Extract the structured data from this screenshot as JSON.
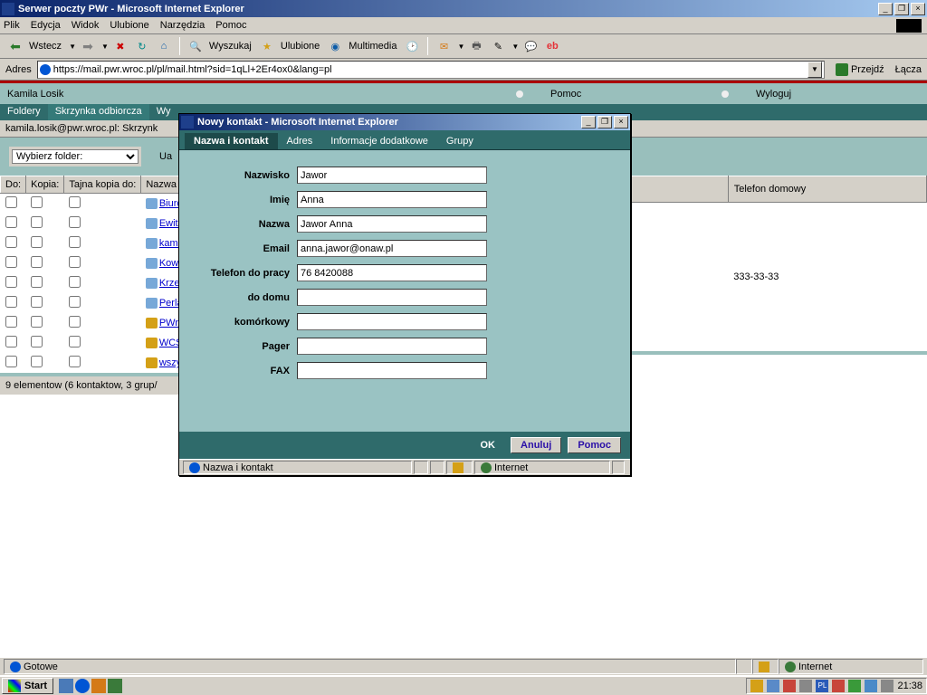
{
  "mainwin": {
    "title": "Serwer poczty PWr - Microsoft Internet Explorer",
    "menu": [
      "Plik",
      "Edycja",
      "Widok",
      "Ulubione",
      "Narzędzia",
      "Pomoc"
    ],
    "toolbar": {
      "back": "Wstecz",
      "search": "Wyszukaj",
      "fav": "Ulubione",
      "media": "Multimedia"
    },
    "addrlabel": "Adres",
    "url": "https://mail.pwr.wroc.pl/pl/mail.html?sid=1qLl+2Er4ox0&lang=pl",
    "go": "Przejdź",
    "links": "Łącza"
  },
  "web": {
    "user": "Kamila Losik",
    "nav": {
      "help": "Pomoc",
      "logout": "Wyloguj"
    },
    "tabs": [
      "Foldery",
      "Skrzynka odbiorcza",
      "Wy"
    ],
    "subhdr": "kamila.losik@pwr.wroc.pl: Skrzynk",
    "folder_select": "Wybierz folder:",
    "ua": "Ua",
    "th": {
      "to": "Do:",
      "cc": "Kopia:",
      "bcc": "Tajna kopia do:",
      "name": "Nazwa",
      "homephone": "Telefon domowy"
    },
    "contacts": [
      "Biuro Grantó",
      "Ewita Edwar",
      "kamila.losik",
      "Kowalski To",
      "Krzewa Jasi",
      "Perla Malgo",
      "PWr",
      "WCSS",
      "wszyscy"
    ],
    "phones": [
      "",
      "",
      "",
      "",
      "333-33-33",
      "",
      "",
      "",
      ""
    ],
    "elemcount": "9 elementow (6 kontaktow, 3 grup/"
  },
  "popup": {
    "title": "Nowy kontakt - Microsoft Internet Explorer",
    "tabs": [
      "Nazwa i kontakt",
      "Adres",
      "Informacje dodatkowe",
      "Grupy"
    ],
    "fields": {
      "nazwisko": {
        "label": "Nazwisko",
        "value": "Jawor"
      },
      "imie": {
        "label": "Imię",
        "value": "Anna"
      },
      "nazwa": {
        "label": "Nazwa",
        "value": "Jawor Anna"
      },
      "email": {
        "label": "Email",
        "value": "anna.jawor@onaw.pl"
      },
      "telpraca": {
        "label": "Telefon do pracy",
        "value": "76 8420088"
      },
      "teldom": {
        "label": "do domu",
        "value": ""
      },
      "komorka": {
        "label": "komórkowy",
        "value": ""
      },
      "pager": {
        "label": "Pager",
        "value": ""
      },
      "fax": {
        "label": "FAX",
        "value": ""
      }
    },
    "buttons": {
      "ok": "OK",
      "cancel": "Anuluj",
      "help": "Pomoc"
    },
    "status": "Nazwa i kontakt",
    "zone": "Internet"
  },
  "status": {
    "main": "Gotowe",
    "zone": "Internet"
  },
  "taskbar": {
    "start": "Start",
    "lang": "PL",
    "clock": "21:38"
  }
}
